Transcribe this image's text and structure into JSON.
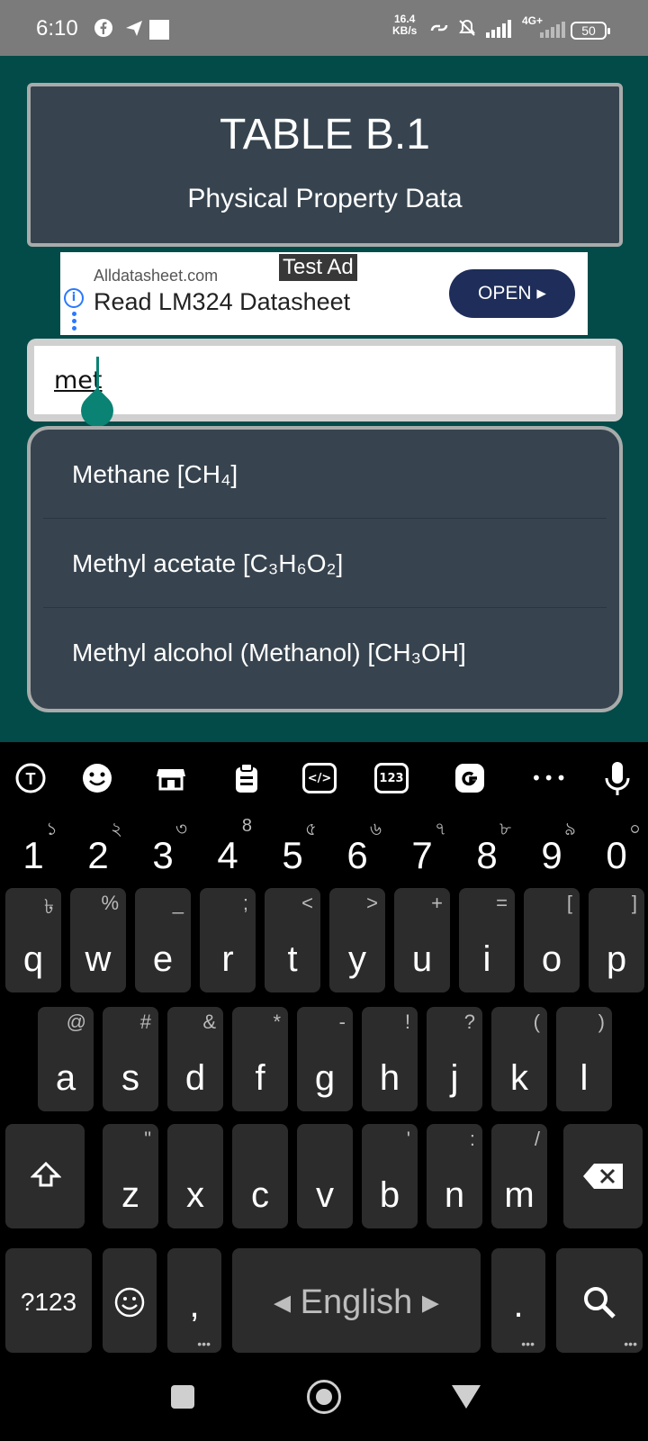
{
  "status_bar": {
    "time": "6:10",
    "net_speed_value": "16.4",
    "net_speed_unit": "KB/s",
    "network": "4G+",
    "battery": "50"
  },
  "header": {
    "title": "TABLE B.1",
    "subtitle": "Physical Property Data"
  },
  "ad": {
    "tag": "Test Ad",
    "site": "Alldatasheet.com",
    "headline": "Read LM324 Datasheet",
    "button": "OPEN ▸"
  },
  "search": {
    "value": "met"
  },
  "suggestions": [
    "Methane [CH₄]",
    "Methyl acetate [C₃H₆O₂]",
    "Methyl alcohol (Methanol) [CH₃OH]"
  ],
  "keyboard": {
    "toolbar": {
      "code_label": "</>",
      "num_label": "123",
      "more_label": "•••"
    },
    "number_row": [
      {
        "k": "1",
        "h": "১"
      },
      {
        "k": "2",
        "h": "২"
      },
      {
        "k": "3",
        "h": "৩"
      },
      {
        "k": "4",
        "h": "8"
      },
      {
        "k": "5",
        "h": "৫"
      },
      {
        "k": "6",
        "h": "৬"
      },
      {
        "k": "7",
        "h": "৭"
      },
      {
        "k": "8",
        "h": "৮"
      },
      {
        "k": "9",
        "h": "৯"
      },
      {
        "k": "0",
        "h": "০"
      }
    ],
    "row1": [
      {
        "k": "q",
        "h": "৳"
      },
      {
        "k": "w",
        "h": "%"
      },
      {
        "k": "e",
        "h": "_"
      },
      {
        "k": "r",
        "h": ";"
      },
      {
        "k": "t",
        "h": "<"
      },
      {
        "k": "y",
        "h": ">"
      },
      {
        "k": "u",
        "h": "+"
      },
      {
        "k": "i",
        "h": "="
      },
      {
        "k": "o",
        "h": "["
      },
      {
        "k": "p",
        "h": "]"
      }
    ],
    "row2": [
      {
        "k": "a",
        "h": "@"
      },
      {
        "k": "s",
        "h": "#"
      },
      {
        "k": "d",
        "h": "&"
      },
      {
        "k": "f",
        "h": "*"
      },
      {
        "k": "g",
        "h": "-"
      },
      {
        "k": "h",
        "h": "!"
      },
      {
        "k": "j",
        "h": "?"
      },
      {
        "k": "k",
        "h": "("
      },
      {
        "k": "l",
        "h": ")"
      }
    ],
    "row3": [
      {
        "k": "z",
        "h": "\""
      },
      {
        "k": "x",
        "h": ""
      },
      {
        "k": "c",
        "h": ""
      },
      {
        "k": "v",
        "h": ""
      },
      {
        "k": "b",
        "h": "'"
      },
      {
        "k": "n",
        "h": ":"
      },
      {
        "k": "m",
        "h": "/"
      }
    ],
    "symbols_label": "?123",
    "comma_label": ",",
    "space_label": "◂ English ▸",
    "period_label": "."
  }
}
